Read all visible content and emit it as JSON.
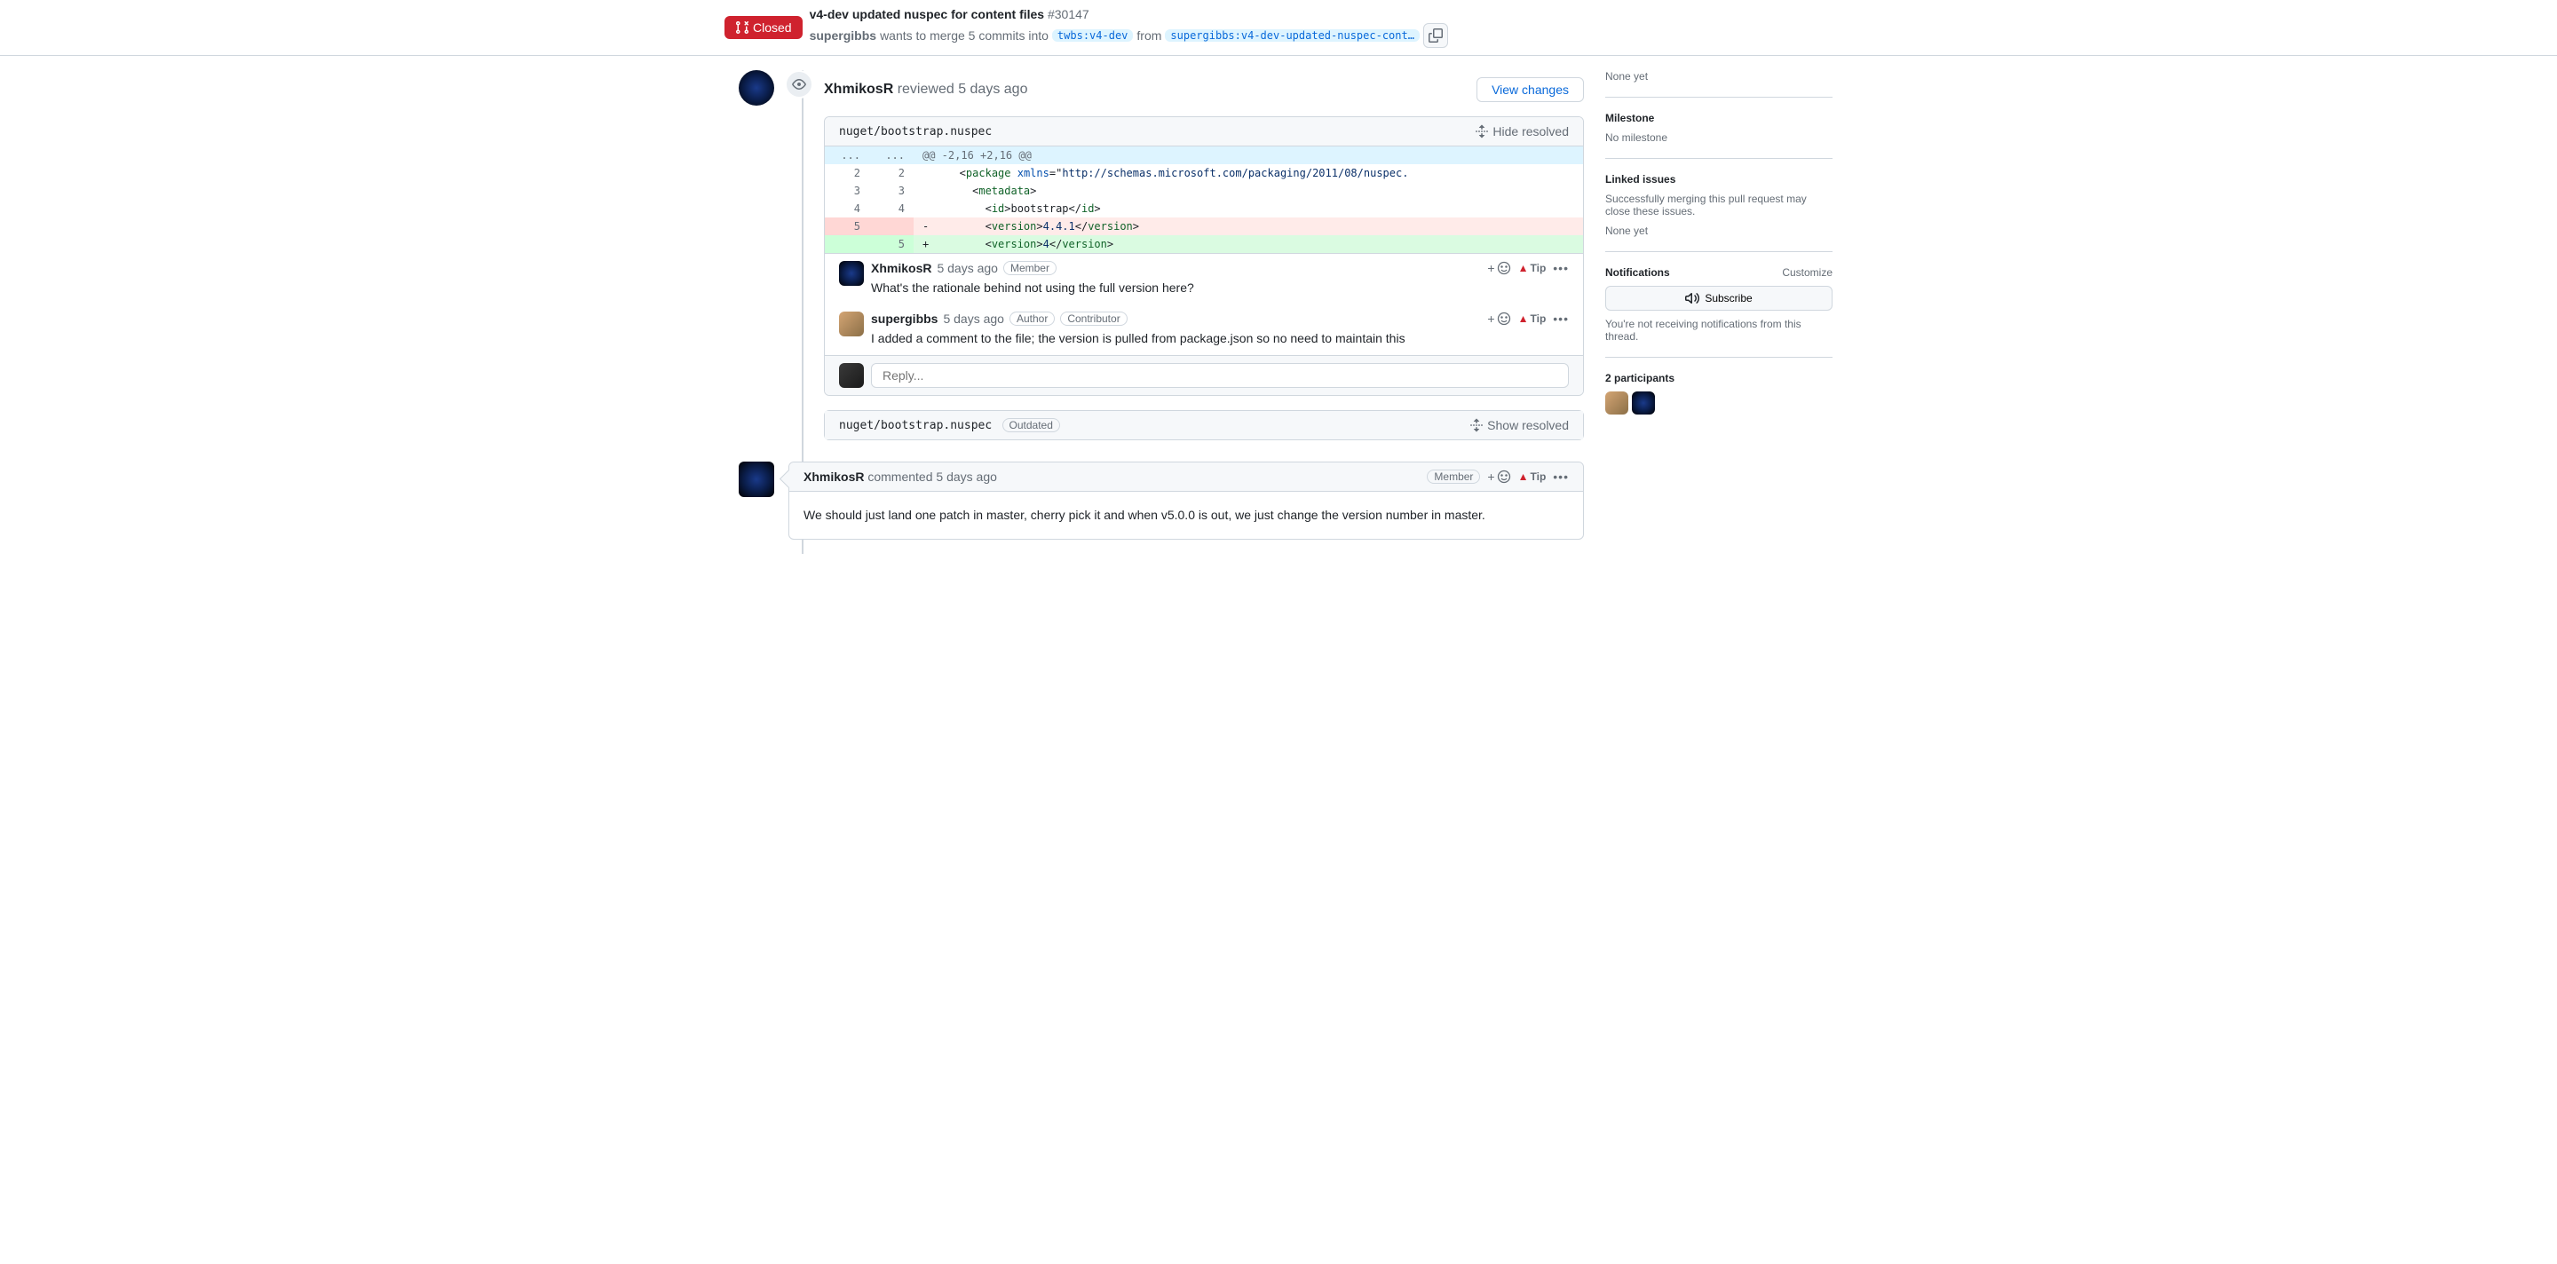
{
  "header": {
    "state": "Closed",
    "title": "v4-dev updated nuspec for content files",
    "number": "#30147",
    "author": "supergibbs",
    "wants_text": "wants to merge 5 commits into",
    "base_branch": "twbs:v4-dev",
    "from_text": "from",
    "head_branch": "supergibbs:v4-dev-updated-nuspec-cont…"
  },
  "review": {
    "author": "XhmikosR",
    "action": "reviewed",
    "time": "5 days ago",
    "view_changes": "View changes",
    "file_path": "nuget/bootstrap.nuspec",
    "hide_resolved": "Hide resolved",
    "hunk": "@@ -2,16 +2,16 @@",
    "comments": [
      {
        "author": "XhmikosR",
        "time": "5 days ago",
        "badges": [
          "Member"
        ],
        "text": "What's the rationale behind not using the full version here?"
      },
      {
        "author": "supergibbs",
        "time": "5 days ago",
        "badges": [
          "Author",
          "Contributor"
        ],
        "text": "I added a comment to the file; the version is pulled from package.json so no need to maintain this"
      }
    ],
    "reply_placeholder": "Reply...",
    "tip_label": "Tip"
  },
  "collapsed": {
    "file_path": "nuget/bootstrap.nuspec",
    "outdated": "Outdated",
    "show_resolved": "Show resolved"
  },
  "comment": {
    "author": "XhmikosR",
    "action": "commented",
    "time": "5 days ago",
    "badge": "Member",
    "text": "We should just land one patch in master, cherry pick it and when v5.0.0 is out, we just change the version number in master.",
    "tip_label": "Tip"
  },
  "sidebar": {
    "none_yet_top": "None yet",
    "milestone_heading": "Milestone",
    "milestone_value": "No milestone",
    "linked_heading": "Linked issues",
    "linked_desc": "Successfully merging this pull request may close these issues.",
    "linked_value": "None yet",
    "notifications_heading": "Notifications",
    "customize": "Customize",
    "subscribe": "Subscribe",
    "notifications_desc": "You're not receiving notifications from this thread.",
    "participants_heading": "2 participants"
  },
  "diff": {
    "l2": {
      "old": "2",
      "new": "2",
      "pre": "  <",
      "tag1": "package",
      "sp": " ",
      "attr": "xmlns",
      "eq": "=\"",
      "url": "http://schemas.microsoft.com/packaging/2011/08/nuspec."
    },
    "l3": {
      "old": "3",
      "new": "3",
      "pre": "    <",
      "tag": "metadata",
      "post": ">"
    },
    "l4": {
      "old": "4",
      "new": "4",
      "pre": "      <",
      "tag": "id",
      "mid": ">bootstrap</",
      "tag2": "id",
      "post": ">"
    },
    "l5d": {
      "old": "5",
      "marker": "-",
      "pre": "      <",
      "tag": "version",
      "mid": ">",
      "val": "4.4.1",
      "mid2": "</",
      "tag2": "version",
      "post": ">"
    },
    "l5a": {
      "new": "5",
      "marker": "+",
      "pre": "      <",
      "tag": "version",
      "mid": ">",
      "val": "4",
      "mid2": "</",
      "tag2": "version",
      "post": ">"
    }
  }
}
